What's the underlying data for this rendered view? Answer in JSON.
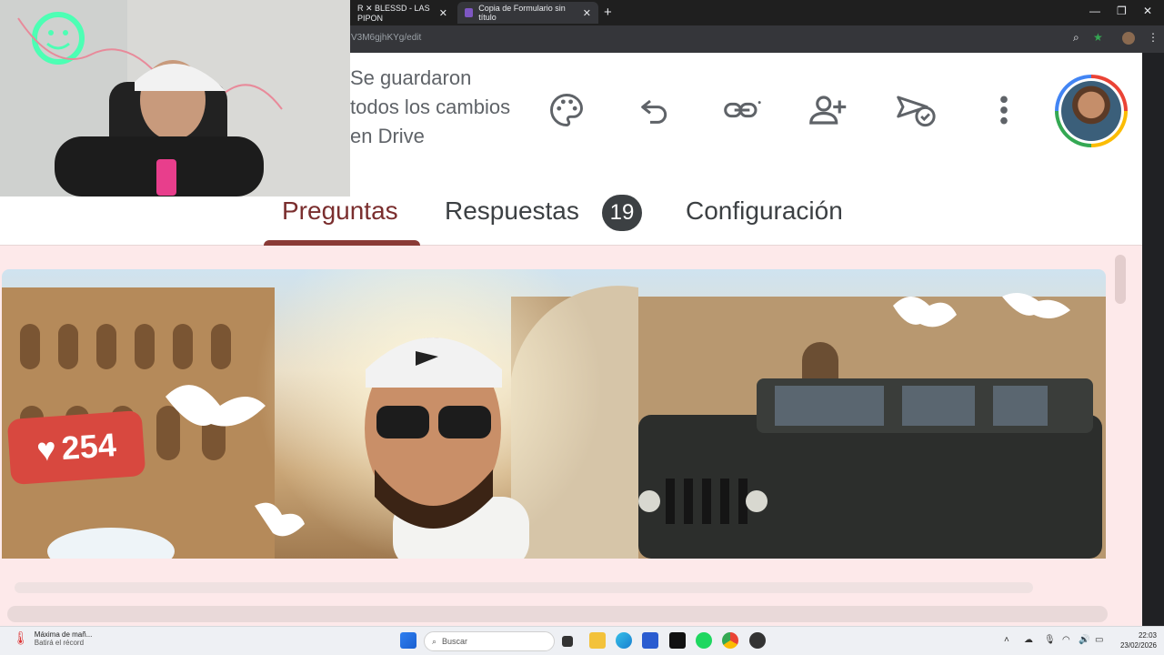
{
  "browser": {
    "tabs": [
      {
        "label": "R ✕ BLESSD - LAS PIPON"
      },
      {
        "label": "Copia de Formulario sin título"
      }
    ],
    "url": "V3M6gjhKYg/edit"
  },
  "form": {
    "save_status": "Se guardaron todos los cambios en Drive",
    "tabs": {
      "preguntas": "Preguntas",
      "respuestas": "Respuestas",
      "respuestas_count": "19",
      "configuracion": "Configuración"
    },
    "banner": {
      "likes": "254"
    }
  },
  "taskbar": {
    "weather_title": "Máxima de mañ...",
    "weather_sub": "Batirá el récord",
    "search_placeholder": "Buscar",
    "time": "22:03",
    "date": "23/02/2026"
  },
  "colors": {
    "accent": "#7a2e2e",
    "page_bg": "#fde9ea",
    "badge_bg": "#3c4043"
  }
}
